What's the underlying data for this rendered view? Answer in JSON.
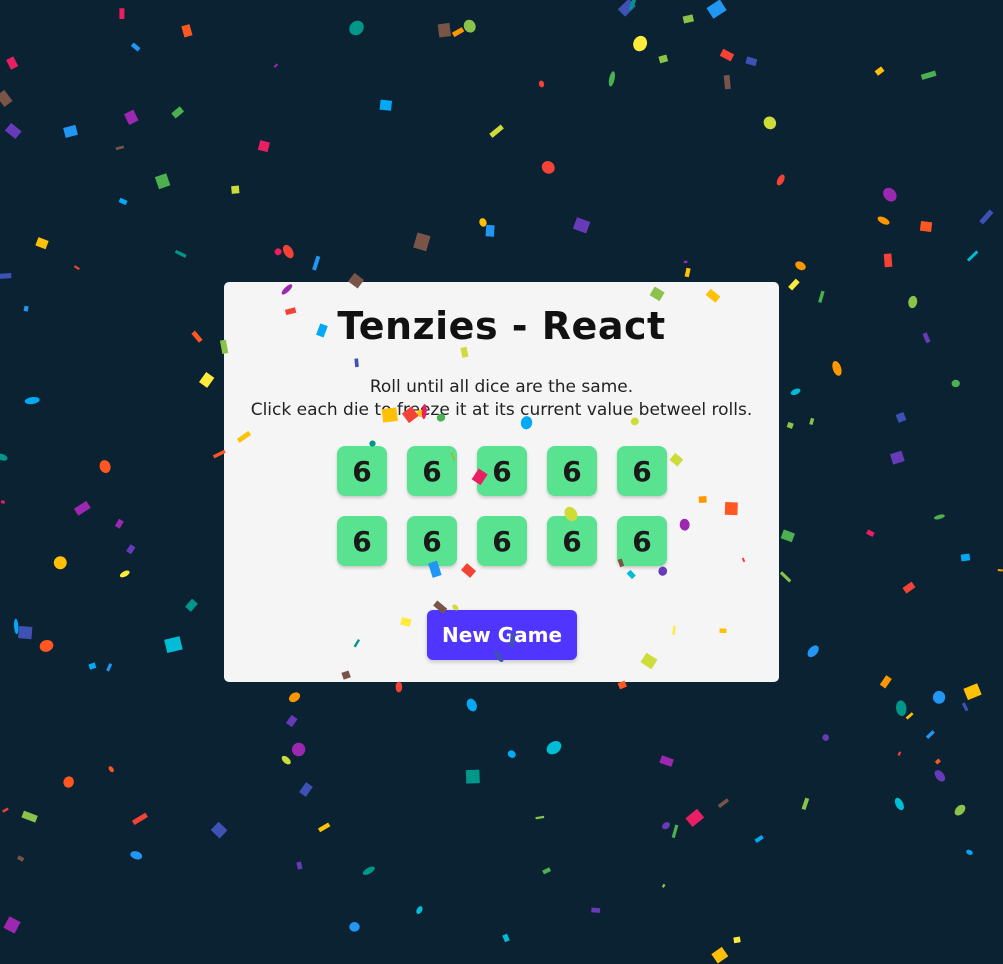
{
  "app": {
    "title": "Tenzies - React",
    "instructions": [
      "Roll until all dice are the same.",
      "Click each die to freeze it at its current value betweel rolls."
    ]
  },
  "dice": [
    "6",
    "6",
    "6",
    "6",
    "6",
    "6",
    "6",
    "6",
    "6",
    "6"
  ],
  "controls": {
    "new_game_label": "New Game"
  },
  "colors": {
    "background": "#0b2233",
    "card": "#f5f5f5",
    "die_held": "#59e391",
    "button": "#5035ff"
  },
  "confetti": {
    "shown": true,
    "palette": [
      "#f44336",
      "#e91e63",
      "#9c27b0",
      "#673ab7",
      "#3f51b5",
      "#2196f3",
      "#03a9f4",
      "#00bcd4",
      "#009688",
      "#4caf50",
      "#8bc34a",
      "#cddc39",
      "#ffeb3b",
      "#ffc107",
      "#ff9800",
      "#ff5722",
      "#795548"
    ]
  }
}
